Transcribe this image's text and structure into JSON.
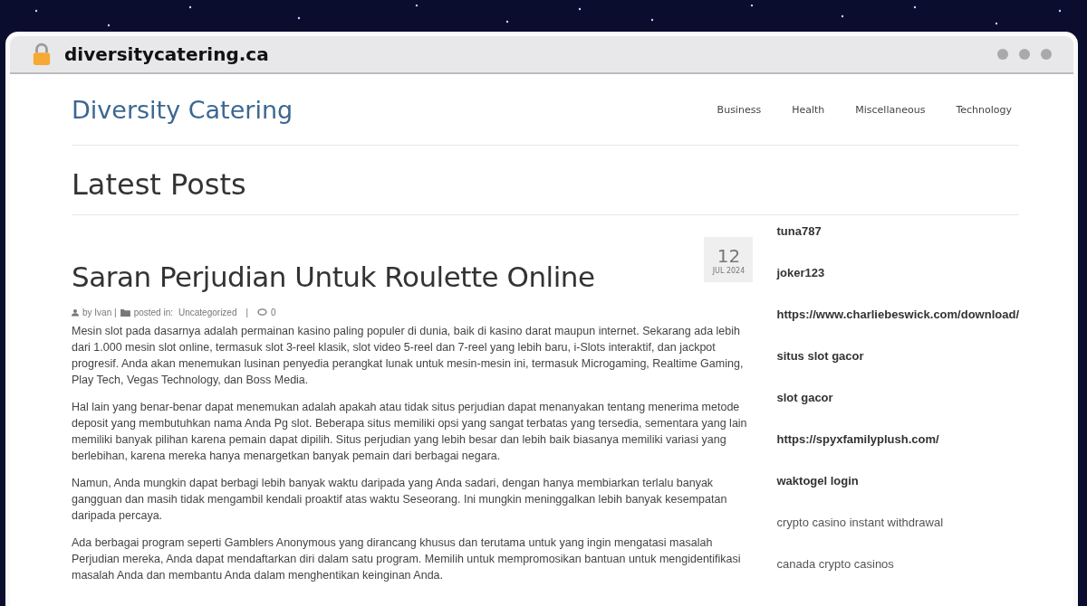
{
  "browser": {
    "address": "diversitycatering.ca"
  },
  "site": {
    "title": "Diversity Catering",
    "nav": [
      {
        "label": "Business"
      },
      {
        "label": "Health"
      },
      {
        "label": "Miscellaneous"
      },
      {
        "label": "Technology"
      }
    ]
  },
  "page_heading": "Latest Posts",
  "post": {
    "title": "Saran Perjudian Untuk Roulette Online",
    "date_day": "12",
    "date_month": "JUL 2024",
    "meta": {
      "author": "by Ivan |",
      "posted_label": "posted in:",
      "category": "Uncategorized",
      "separator": "|",
      "comments": "0"
    },
    "paragraphs": [
      "Mesin slot pada dasarnya adalah permainan kasino paling populer di dunia, baik di kasino darat maupun internet. Sekarang ada lebih dari 1.000 mesin slot online, termasuk slot 3-reel klasik, slot video 5-reel dan 7-reel yang lebih baru, i-Slots interaktif, dan jackpot progresif. Anda akan menemukan lusinan penyedia perangkat lunak untuk mesin-mesin ini, termasuk Microgaming, Realtime Gaming, Play Tech, Vegas Technology, dan Boss Media.",
      "Hal lain yang benar-benar dapat menemukan adalah apakah atau tidak situs perjudian dapat menanyakan tentang menerima metode deposit yang membutuhkan nama Anda Pg slot. Beberapa situs memiliki opsi yang sangat terbatas yang tersedia, sementara yang lain memiliki banyak pilihan karena pemain dapat dipilih. Situs perjudian yang lebih besar dan lebih baik biasanya memiliki variasi yang berlebihan, karena mereka hanya menargetkan banyak pemain dari berbagai negara.",
      "Namun, Anda mungkin dapat berbagi lebih banyak waktu daripada yang Anda sadari, dengan hanya membiarkan terlalu banyak gangguan dan masih tidak mengambil kendali proaktif atas waktu Seseorang. Ini mungkin meninggalkan lebih banyak kesempatan daripada percaya.",
      "Ada berbagai program seperti Gamblers Anonymous yang dirancang khusus dan terutama untuk yang ingin mengatasi masalah Perjudian mereka, Anda dapat mendaftarkan diri dalam satu program. Memilih untuk mempromosikan bantuan untuk mengidentifikasi masalah Anda dan membantu Anda dalam menghentikan keinginan Anda."
    ]
  },
  "sidebar": {
    "links": [
      {
        "label": "tuna787",
        "bold": true
      },
      {
        "label": "joker123",
        "bold": true
      },
      {
        "label": "https://www.charliebeswick.com/download/",
        "bold": true
      },
      {
        "label": "situs slot gacor",
        "bold": true
      },
      {
        "label": "slot gacor",
        "bold": true
      },
      {
        "label": "https://spyxfamilyplush.com/",
        "bold": true
      },
      {
        "label": "waktogel login",
        "bold": true
      },
      {
        "label": "crypto casino instant withdrawal",
        "bold": false
      },
      {
        "label": "canada crypto casinos",
        "bold": false
      }
    ]
  }
}
